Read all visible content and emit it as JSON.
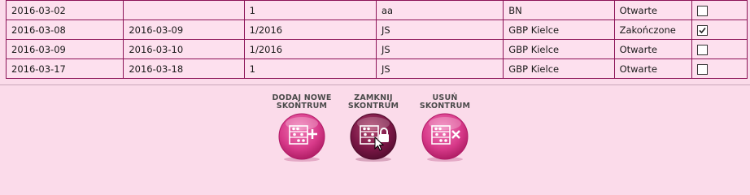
{
  "table": {
    "rows": [
      {
        "start": "2016-03-02",
        "end": "",
        "number": "1",
        "author": "aa",
        "location": "BN",
        "status": "Otwarte",
        "checked": false
      },
      {
        "start": "2016-03-08",
        "end": "2016-03-09",
        "number": "1/2016",
        "author": "JS",
        "location": "GBP Kielce",
        "status": "Zakończone",
        "checked": true
      },
      {
        "start": "2016-03-09",
        "end": "2016-03-10",
        "number": "1/2016",
        "author": "JS",
        "location": "GBP Kielce",
        "status": "Otwarte",
        "checked": false
      },
      {
        "start": "2016-03-17",
        "end": "2016-03-18",
        "number": "1",
        "author": "JS",
        "location": "GBP Kielce",
        "status": "Otwarte",
        "checked": false
      }
    ]
  },
  "actions": {
    "add": {
      "line1": "DODAJ NOWE",
      "line2": "SKONTRUM",
      "icon": "abacus-add-icon"
    },
    "close": {
      "line1": "ZAMKNIJ",
      "line2": "SKONTRUM",
      "icon": "abacus-lock-icon"
    },
    "delete": {
      "line1": "USUŃ",
      "line2": "SKONTRUM",
      "icon": "abacus-delete-icon"
    }
  },
  "colors": {
    "background": "#fbdbea",
    "border": "#8c1458",
    "button_pink": "#d83a8a",
    "button_dark": "#7a1746"
  }
}
